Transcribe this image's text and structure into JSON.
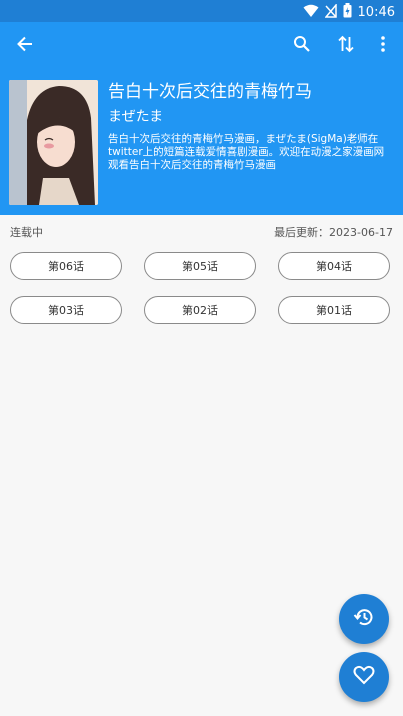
{
  "status_bar": {
    "time": "10:46",
    "icons": [
      "wifi-icon",
      "signal-off-icon",
      "battery-charging-icon"
    ]
  },
  "toolbar": {
    "icons": [
      "back-arrow-icon",
      "search-icon",
      "sort-icon",
      "more-vert-icon"
    ]
  },
  "comic": {
    "title": "告白十次后交往的青梅竹马",
    "author": "まぜたま",
    "description": "告白十次后交往的青梅竹马漫画，まぜたま(SigMa)老师在twitter上的短篇连载爱情喜剧漫画。欢迎在动漫之家漫画网观看告白十次后交往的青梅竹马漫画",
    "status": "连载中",
    "last_updated": "最后更新：2023-06-17"
  },
  "chapters": [
    "第06话",
    "第05话",
    "第04话",
    "第03话",
    "第02话",
    "第01话"
  ],
  "fabs": [
    "history-icon",
    "heart-icon"
  ],
  "colors": {
    "primary": "#2196f3",
    "status_bar": "#1f7fd4",
    "fab": "#1f7fd4"
  }
}
